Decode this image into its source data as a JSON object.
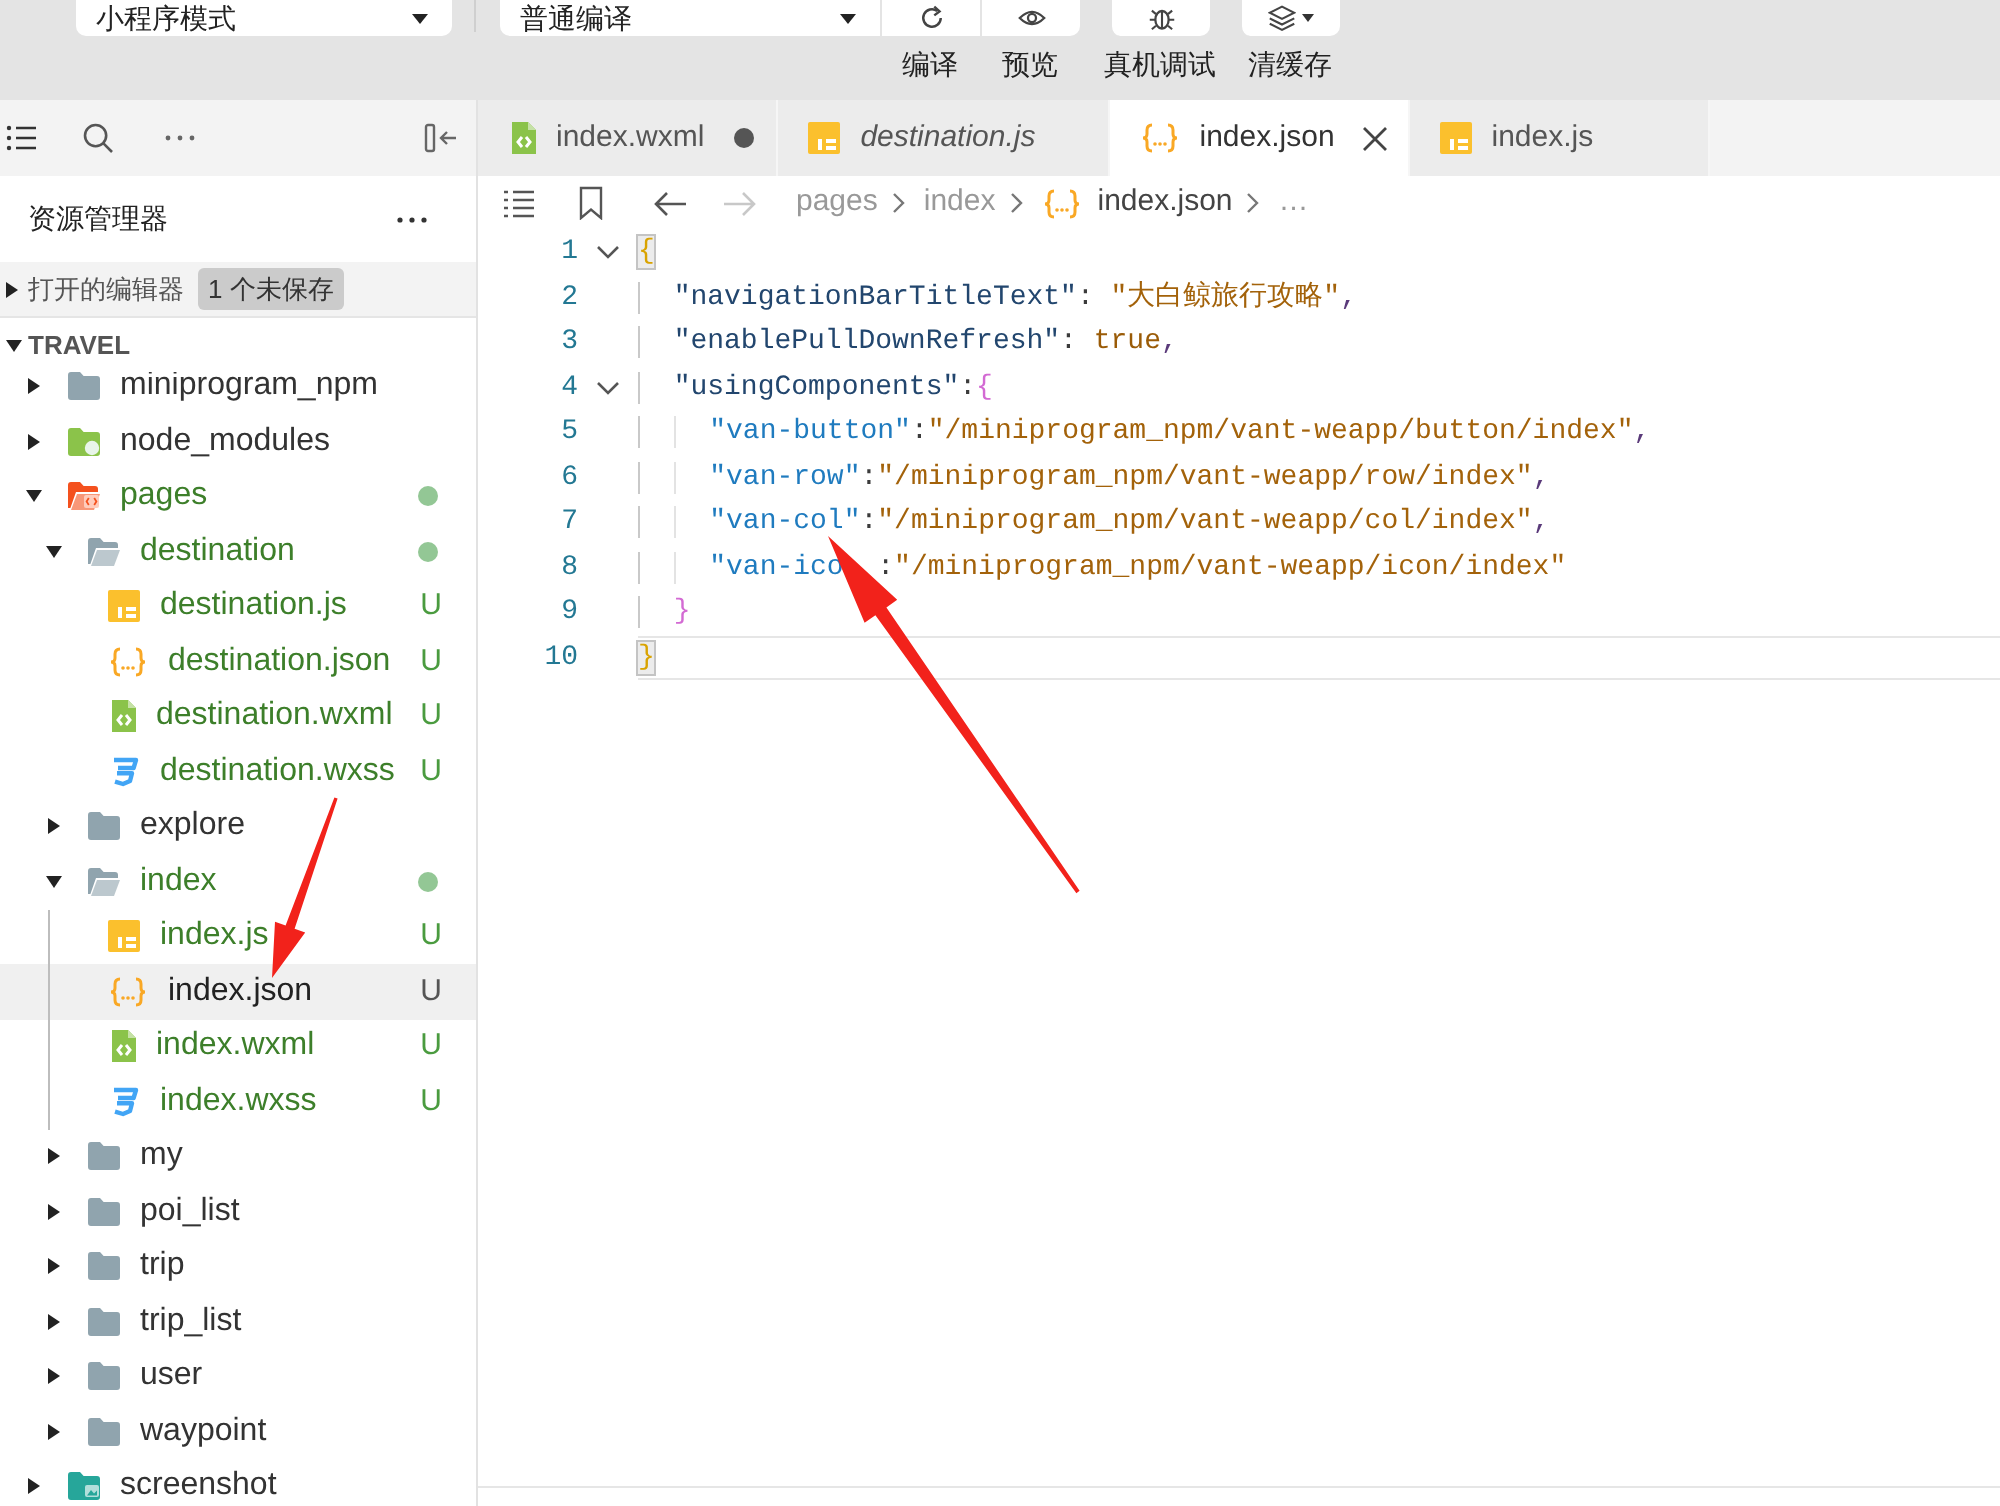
{
  "toolbar": {
    "mode_select": {
      "value": "小程序模式"
    },
    "compile_select": {
      "value": "普通编译"
    },
    "buttons": [
      {
        "kind": "compile",
        "label": "编译"
      },
      {
        "kind": "preview",
        "label": "预览"
      },
      {
        "kind": "remote-debug",
        "label": "真机调试"
      },
      {
        "kind": "clear-cache",
        "label": "清缓存"
      }
    ]
  },
  "sidebar": {
    "title": "资源管理器",
    "open_editors": {
      "label": "打开的编辑器",
      "badge": "1 个未保存",
      "expanded": false
    },
    "project": {
      "label": "TRAVEL",
      "expanded": true
    },
    "tree": [
      {
        "name": "miniprogram_npm",
        "kind": "folder",
        "expanded": false,
        "selected": false,
        "untracked": false,
        "changes": false
      },
      {
        "name": "node_modules",
        "kind": "folder-node",
        "expanded": false,
        "selected": false,
        "untracked": false,
        "changes": false
      },
      {
        "name": "pages",
        "kind": "folder-pages",
        "expanded": true,
        "selected": false,
        "untracked": true,
        "changes": true,
        "children": [
          {
            "name": "destination",
            "kind": "folder",
            "expanded": true,
            "selected": false,
            "untracked": true,
            "changes": true,
            "children": [
              {
                "name": "destination.js",
                "kind": "js",
                "status": "U",
                "selected": false,
                "untracked": true,
                "changes": false
              },
              {
                "name": "destination.json",
                "kind": "json",
                "status": "U",
                "selected": false,
                "untracked": true,
                "changes": false
              },
              {
                "name": "destination.wxml",
                "kind": "wxml",
                "status": "U",
                "selected": false,
                "untracked": true,
                "changes": false
              },
              {
                "name": "destination.wxss",
                "kind": "wxss",
                "status": "U",
                "selected": false,
                "untracked": true,
                "changes": false
              }
            ]
          },
          {
            "name": "explore",
            "kind": "folder",
            "expanded": false,
            "selected": false,
            "untracked": false,
            "changes": false
          },
          {
            "name": "index",
            "kind": "folder",
            "expanded": true,
            "selected": false,
            "untracked": true,
            "changes": true,
            "children": [
              {
                "name": "index.js",
                "kind": "js",
                "status": "U",
                "selected": false,
                "untracked": true,
                "changes": false
              },
              {
                "name": "index.json",
                "kind": "json",
                "status": "U",
                "selected": true,
                "untracked": true,
                "changes": false
              },
              {
                "name": "index.wxml",
                "kind": "wxml",
                "status": "U",
                "selected": false,
                "untracked": true,
                "changes": false
              },
              {
                "name": "index.wxss",
                "kind": "wxss",
                "status": "U",
                "selected": false,
                "untracked": true,
                "changes": false
              }
            ]
          },
          {
            "name": "my",
            "kind": "folder",
            "expanded": false,
            "selected": false,
            "untracked": false,
            "changes": false
          },
          {
            "name": "poi_list",
            "kind": "folder",
            "expanded": false,
            "selected": false,
            "untracked": false,
            "changes": false
          },
          {
            "name": "trip",
            "kind": "folder",
            "expanded": false,
            "selected": false,
            "untracked": false,
            "changes": false
          },
          {
            "name": "trip_list",
            "kind": "folder",
            "expanded": false,
            "selected": false,
            "untracked": false,
            "changes": false
          },
          {
            "name": "user",
            "kind": "folder",
            "expanded": false,
            "selected": false,
            "untracked": false,
            "changes": false
          },
          {
            "name": "waypoint",
            "kind": "folder",
            "expanded": false,
            "selected": false,
            "untracked": false,
            "changes": false
          }
        ]
      },
      {
        "name": "screenshot",
        "kind": "folder-images",
        "expanded": false,
        "selected": false,
        "untracked": false,
        "changes": false
      }
    ]
  },
  "editor": {
    "tabs": [
      {
        "label": "index.wxml",
        "kind": "wxml",
        "selected": false,
        "modified": true,
        "preview": false
      },
      {
        "label": "destination.js",
        "kind": "js",
        "selected": false,
        "modified": false,
        "preview": true
      },
      {
        "label": "index.json",
        "kind": "json",
        "selected": true,
        "modified": false,
        "preview": false
      },
      {
        "label": "index.js",
        "kind": "js",
        "selected": false,
        "modified": false,
        "preview": false
      }
    ],
    "navigation": {
      "back": {
        "disabled": false
      },
      "forward": {
        "disabled": true
      }
    },
    "breadcrumb": [
      {
        "label": "pages",
        "kind": "folder"
      },
      {
        "label": "index",
        "kind": "folder"
      },
      {
        "label": "index.json",
        "kind": "json"
      },
      {
        "label": "…",
        "kind": "more"
      }
    ],
    "lines": [
      {
        "number": "1",
        "foldable": true,
        "current": false,
        "tokens": [
          {
            "text": "{",
            "kind": "brace-outer",
            "matched": true
          }
        ]
      },
      {
        "number": "2",
        "foldable": false,
        "current": false,
        "tokens": [
          {
            "text": "  \"navigationBarTitleText\"",
            "kind": "key"
          },
          {
            "text": ": ",
            "kind": "colon"
          },
          {
            "text": "\"大白鲸旅行攻略\"",
            "kind": "string"
          },
          {
            "text": ",",
            "kind": "comma"
          }
        ]
      },
      {
        "number": "3",
        "foldable": false,
        "current": false,
        "tokens": [
          {
            "text": "  \"enablePullDownRefresh\"",
            "kind": "key"
          },
          {
            "text": ": ",
            "kind": "colon"
          },
          {
            "text": "true",
            "kind": "keyword"
          },
          {
            "text": ",",
            "kind": "comma"
          }
        ]
      },
      {
        "number": "4",
        "foldable": true,
        "current": false,
        "tokens": [
          {
            "text": "  \"usingComponents\"",
            "kind": "key"
          },
          {
            "text": ":",
            "kind": "colon"
          },
          {
            "text": "{",
            "kind": "brace-inner",
            "matched": false
          }
        ]
      },
      {
        "number": "5",
        "foldable": false,
        "current": false,
        "tokens": [
          {
            "text": "    \"van-button\"",
            "kind": "subkey"
          },
          {
            "text": ":",
            "kind": "colon"
          },
          {
            "text": "\"/miniprogram_npm/vant-weapp/button/index\"",
            "kind": "string"
          },
          {
            "text": ",",
            "kind": "comma"
          }
        ]
      },
      {
        "number": "6",
        "foldable": false,
        "current": false,
        "tokens": [
          {
            "text": "    \"van-row\"",
            "kind": "subkey"
          },
          {
            "text": ":",
            "kind": "colon"
          },
          {
            "text": "\"/miniprogram_npm/vant-weapp/row/index\"",
            "kind": "string"
          },
          {
            "text": ",",
            "kind": "comma"
          }
        ]
      },
      {
        "number": "7",
        "foldable": false,
        "current": false,
        "tokens": [
          {
            "text": "    \"van-col\"",
            "kind": "subkey"
          },
          {
            "text": ":",
            "kind": "colon"
          },
          {
            "text": "\"/miniprogram_npm/vant-weapp/col/index\"",
            "kind": "string"
          },
          {
            "text": ",",
            "kind": "comma"
          }
        ]
      },
      {
        "number": "8",
        "foldable": false,
        "current": false,
        "tokens": [
          {
            "text": "    \"van-ico",
            "kind": "subkey"
          },
          {
            "kind": "covered"
          },
          {
            "text": ":",
            "kind": "colon"
          },
          {
            "text": "\"/miniprogram_npm/vant-weapp/icon/index\"",
            "kind": "string"
          }
        ]
      },
      {
        "number": "9",
        "foldable": false,
        "current": false,
        "tokens": [
          {
            "text": "  }",
            "kind": "brace-inner",
            "matched": false
          }
        ]
      },
      {
        "number": "10",
        "foldable": false,
        "current": true,
        "tokens": [
          {
            "text": "}",
            "kind": "brace-outer",
            "matched": true
          }
        ]
      }
    ]
  }
}
